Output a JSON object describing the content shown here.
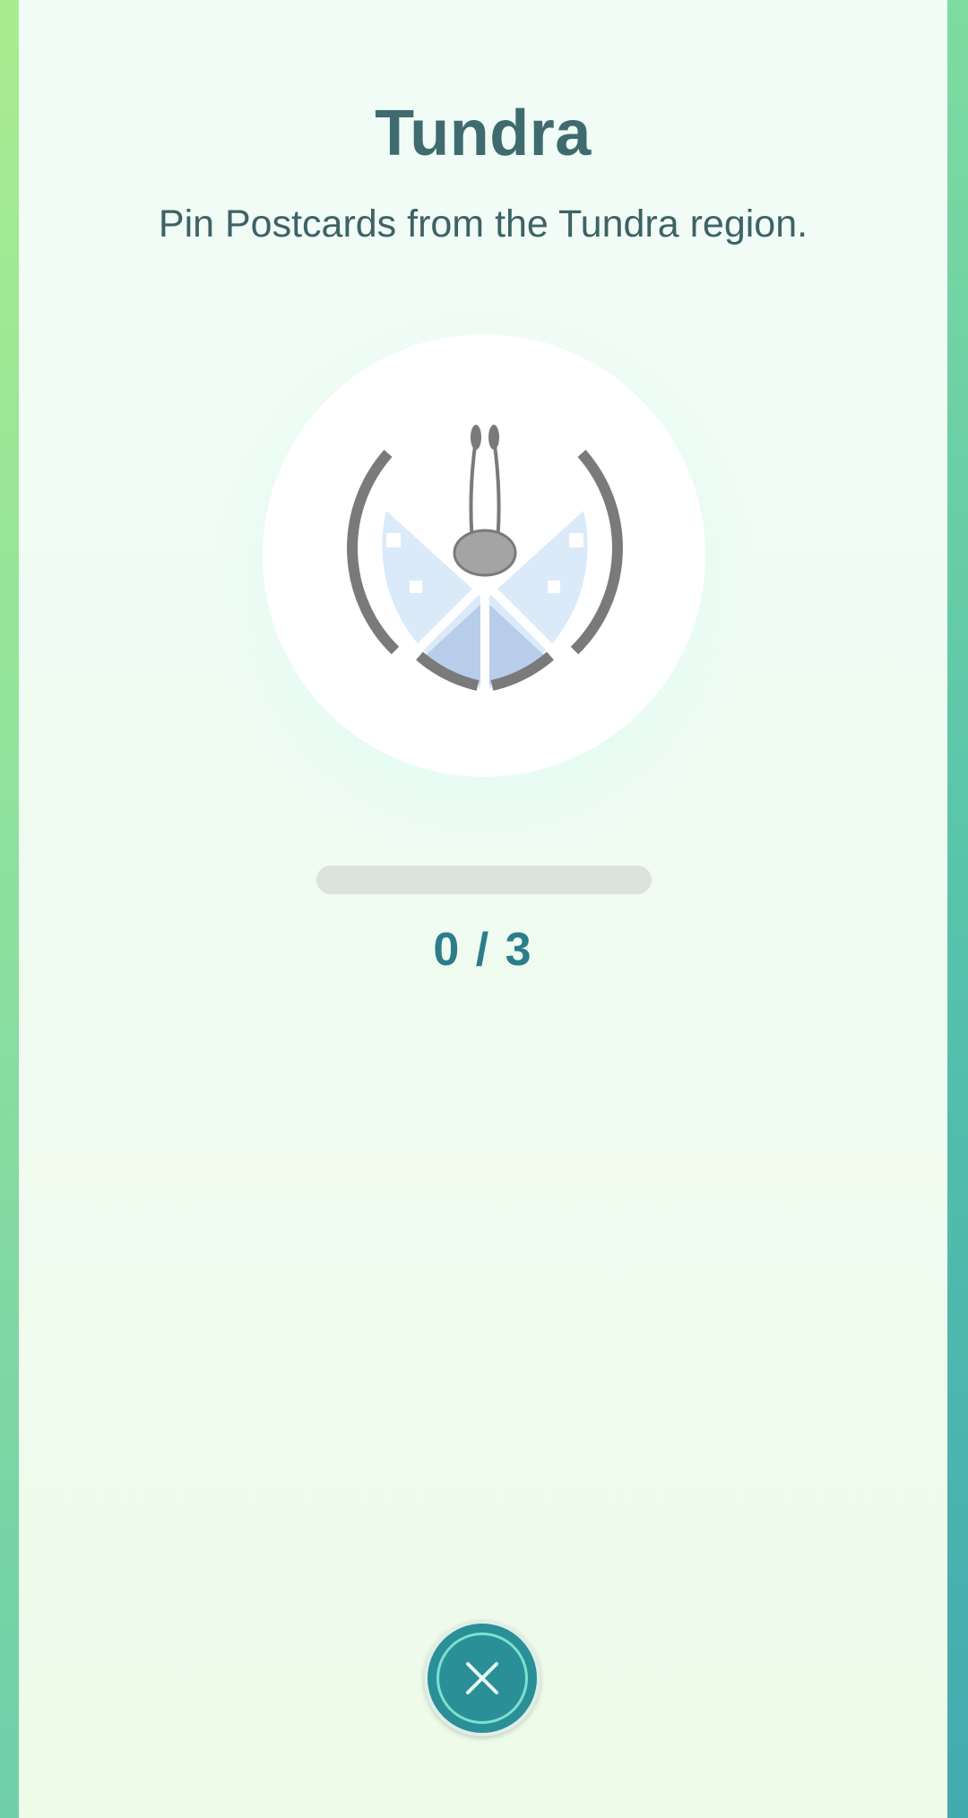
{
  "badge": {
    "title": "Tundra",
    "description": "Pin Postcards from the Tundra region.",
    "icon": "vivillon-tundra-pattern-icon"
  },
  "progress": {
    "current": 0,
    "total": 3,
    "text": "0 / 3",
    "fraction": 0
  },
  "close_button": {
    "icon": "close-icon"
  },
  "colors": {
    "accent": "#2a8f97",
    "title": "#3f6b6e",
    "progress_text": "#2b7d8a"
  }
}
